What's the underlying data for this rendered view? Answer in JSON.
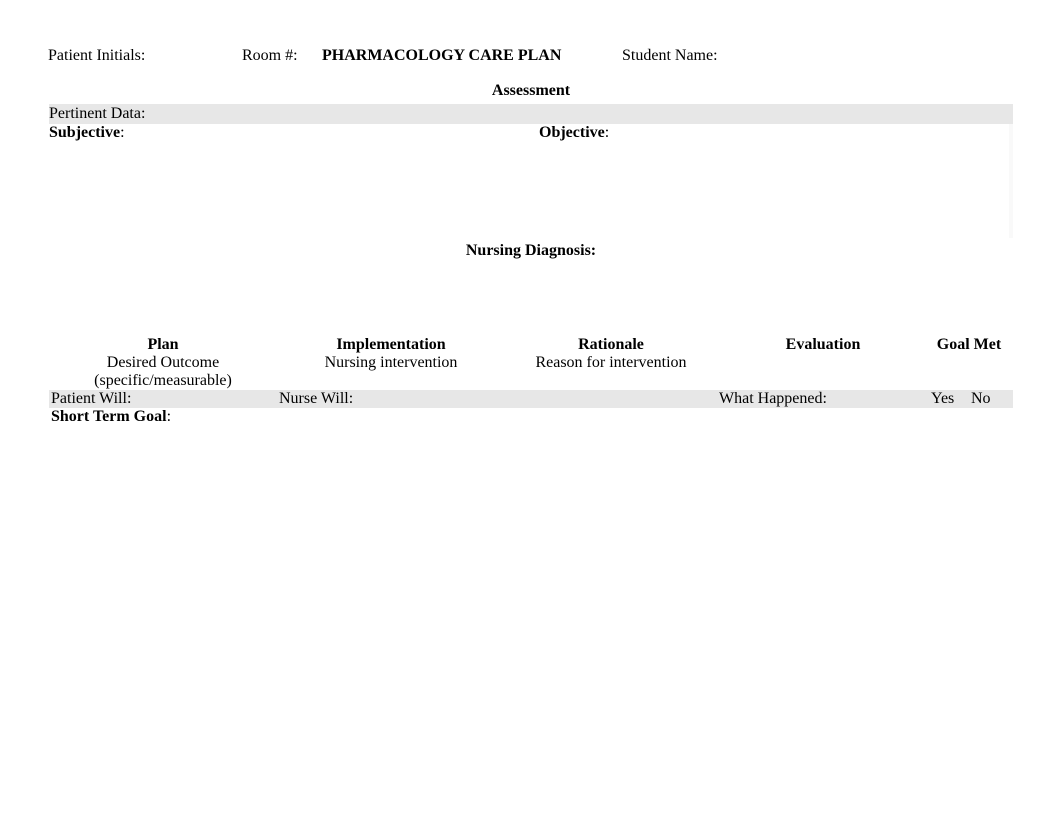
{
  "header": {
    "patient_initials_label": "Patient Initials:",
    "room_label": "Room #:",
    "title": "PHARMACOLOGY CARE PLAN",
    "student_label": "Student Name:"
  },
  "assessment": {
    "heading": "Assessment",
    "pertinent_label": "Pertinent Data:",
    "subjective_label": "Subjective",
    "objective_label": "Objective"
  },
  "diagnosis": {
    "heading": "Nursing Diagnosis:"
  },
  "table": {
    "plan_hd": "Plan",
    "plan_sub1": "Desired Outcome",
    "plan_sub2": "(specific/measurable)",
    "impl_hd": "Implementation",
    "impl_sub": "Nursing intervention",
    "rat_hd": "Rationale",
    "rat_sub": "Reason for intervention",
    "eval_hd": "Evaluation",
    "goal_hd": "Goal Met",
    "patient_will": "Patient Will:",
    "nurse_will": "Nurse Will:",
    "what_happened": "What Happened:",
    "yes": "Yes",
    "no": "No",
    "stg_label": "Short Term Goal"
  }
}
